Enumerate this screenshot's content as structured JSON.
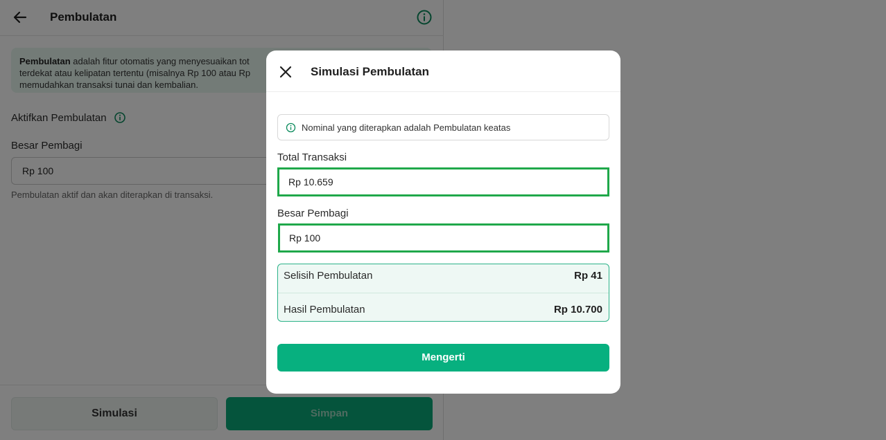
{
  "page": {
    "title": "Pembulatan",
    "banner": {
      "bold_term": "Pembulatan",
      "line1_rest": " adalah fitur otomatis yang menyesuaikan tot",
      "line2": "terdekat atau kelipatan tertentu (misalnya Rp 100 atau Rp",
      "line3": "memudahkan transaksi tunai dan kembalian."
    },
    "toggle_label": "Aktifkan Pembulatan",
    "divider_label": "Besar Pembagi",
    "divider_value": "Rp 100",
    "divider_help": "Pembulatan aktif dan akan diterapkan di transaksi.",
    "buttons": {
      "simulate": "Simulasi",
      "save": "Simpan"
    }
  },
  "modal": {
    "title": "Simulasi Pembulatan",
    "note": "Nominal yang diterapkan adalah Pembulatan keatas",
    "total_label": "Total Transaksi",
    "total_value": "Rp 10.659",
    "divider_label": "Besar Pembagi",
    "divider_value": "Rp 100",
    "results": {
      "diff_label": "Selisih Pembulatan",
      "diff_value": "Rp 41",
      "result_label": "Hasil Pembulatan",
      "result_value": "Rp 10.700"
    },
    "ok_button": "Mengerti"
  },
  "colors": {
    "primary_green": "#07b07f",
    "highlight_border": "#1fa84a",
    "banner_bg": "#e6f6ef",
    "overlay": "rgba(0,0,0,0.5)"
  },
  "icons": [
    "back-arrow-icon",
    "info-icon",
    "close-icon"
  ]
}
